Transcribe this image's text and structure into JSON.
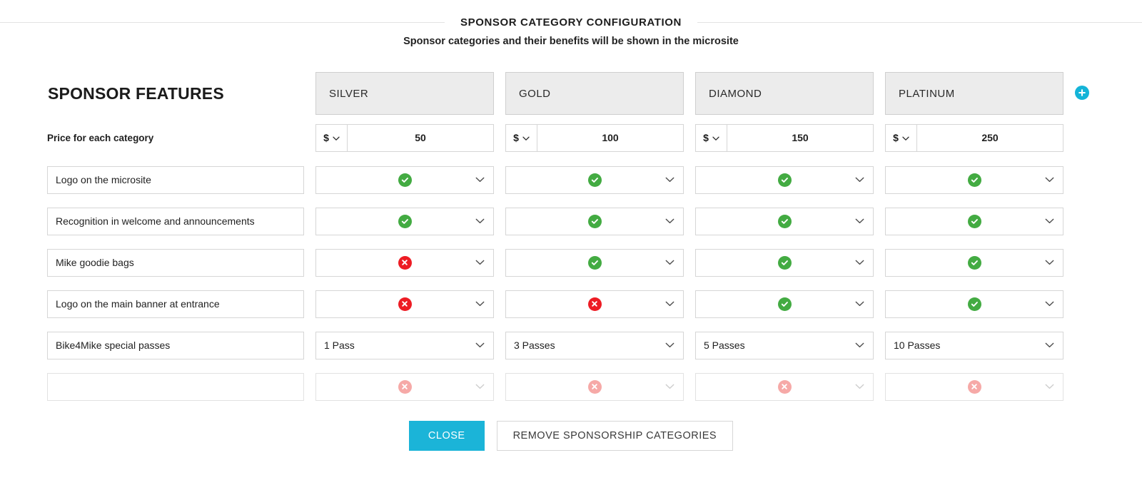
{
  "header": {
    "title": "SPONSOR CATEGORY CONFIGURATION",
    "subtitle": "Sponsor categories and their benefits will be shown in the microsite"
  },
  "table": {
    "features_title": "SPONSOR FEATURES",
    "price_row_label": "Price for each category",
    "currency_symbol": "$",
    "categories": [
      {
        "name": "SILVER",
        "price": "50"
      },
      {
        "name": "GOLD",
        "price": "100"
      },
      {
        "name": "DIAMOND",
        "price": "150"
      },
      {
        "name": "PLATINUM",
        "price": "250"
      }
    ],
    "features": [
      {
        "label": "Logo on the microsite",
        "values": [
          {
            "kind": "yes"
          },
          {
            "kind": "yes"
          },
          {
            "kind": "yes"
          },
          {
            "kind": "yes"
          }
        ]
      },
      {
        "label": "Recognition in welcome and announcements",
        "values": [
          {
            "kind": "yes"
          },
          {
            "kind": "yes"
          },
          {
            "kind": "yes"
          },
          {
            "kind": "yes"
          }
        ]
      },
      {
        "label": "Mike goodie bags",
        "values": [
          {
            "kind": "no"
          },
          {
            "kind": "yes"
          },
          {
            "kind": "yes"
          },
          {
            "kind": "yes"
          }
        ]
      },
      {
        "label": "Logo on the main banner at entrance",
        "values": [
          {
            "kind": "no"
          },
          {
            "kind": "no"
          },
          {
            "kind": "yes"
          },
          {
            "kind": "yes"
          }
        ]
      },
      {
        "label": "Bike4Mike special passes",
        "values": [
          {
            "kind": "text",
            "text": "1 Pass"
          },
          {
            "kind": "text",
            "text": "3 Passes"
          },
          {
            "kind": "text",
            "text": "5 Passes"
          },
          {
            "kind": "text",
            "text": "10 Passes"
          }
        ]
      },
      {
        "label": "",
        "placeholder": "",
        "disabled": true,
        "values": [
          {
            "kind": "no"
          },
          {
            "kind": "no"
          },
          {
            "kind": "no"
          },
          {
            "kind": "no"
          }
        ]
      }
    ]
  },
  "icons": {
    "add": "plus-circle-icon",
    "currency_chevron": "chevron-down-icon",
    "select_chevron": "chevron-down-icon",
    "yes": "check-circle-icon",
    "no": "x-circle-icon"
  },
  "buttons": {
    "close": "CLOSE",
    "remove": "REMOVE SPONSORSHIP CATEGORIES"
  },
  "colors": {
    "accent": "#1bb4d8",
    "yes_green": "#43ab42",
    "no_red": "#ed1c24",
    "header_bg": "#ececec",
    "border": "#d6d6d6"
  }
}
